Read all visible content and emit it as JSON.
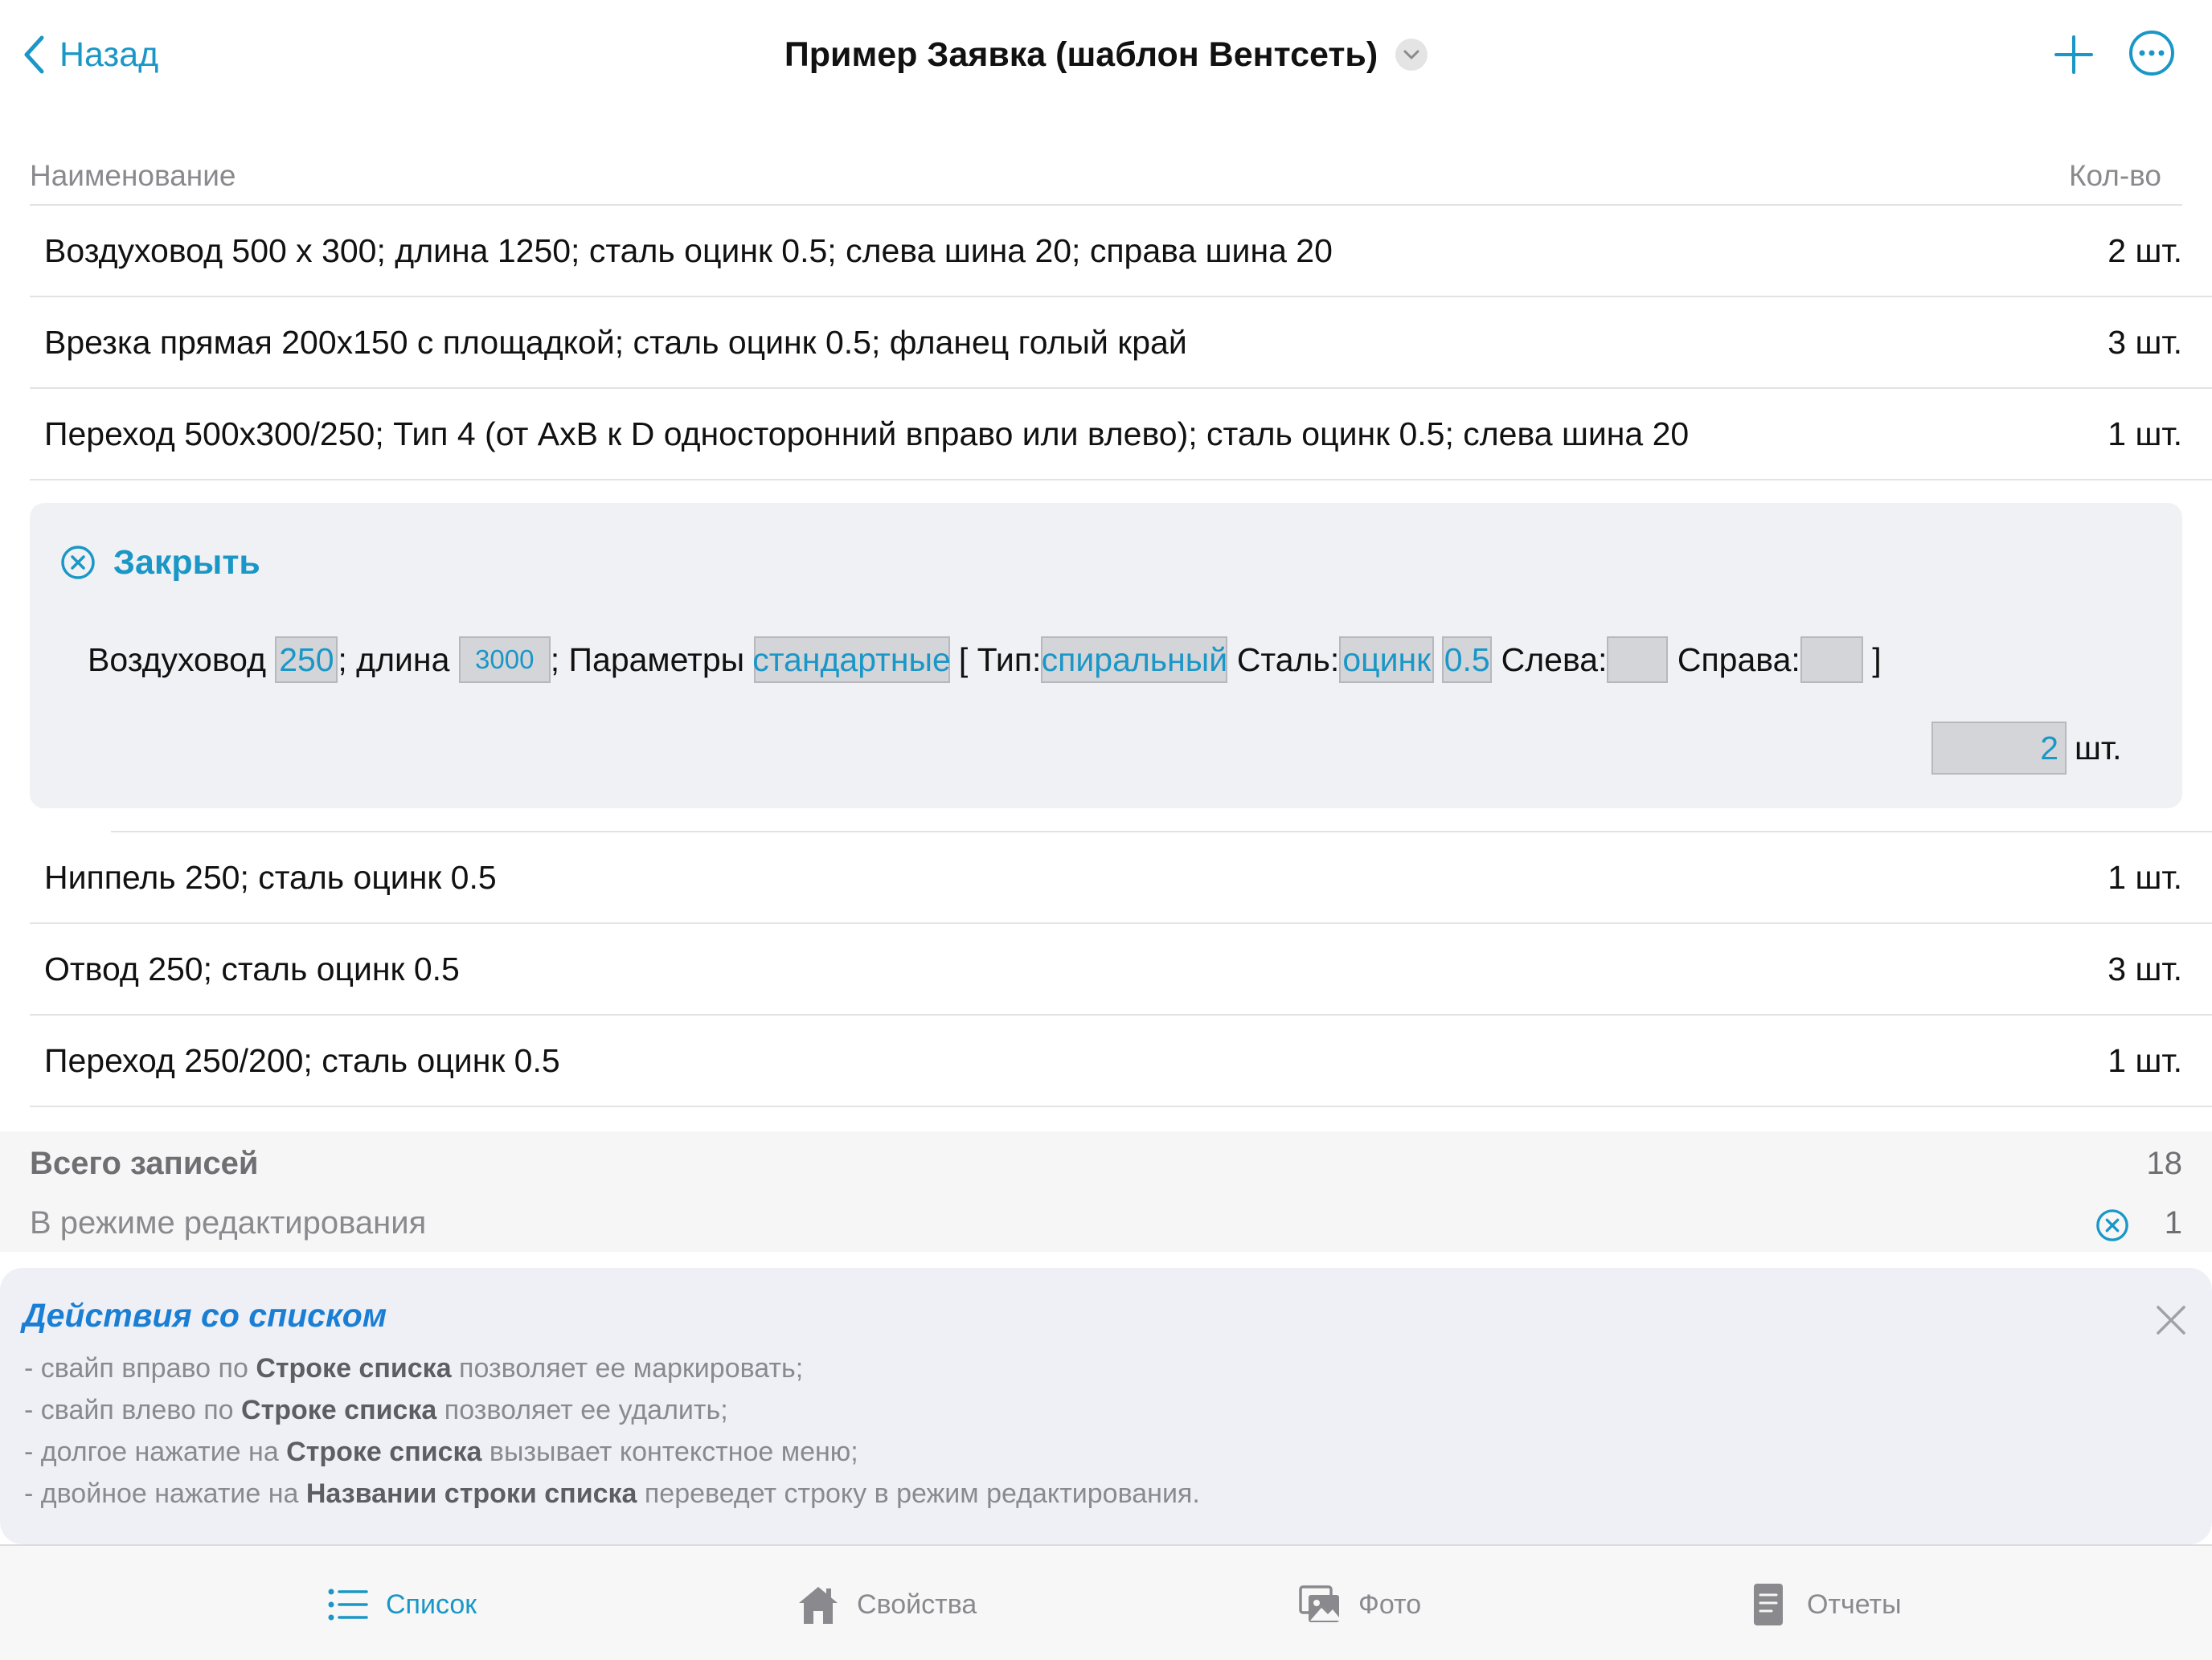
{
  "nav": {
    "back_label": "Назад",
    "title": "Пример Заявка (шаблон Вентсеть)"
  },
  "list": {
    "header_name": "Наименование",
    "header_qty": "Кол-во",
    "rows_before": [
      {
        "name": "Воздуховод 500 х 300; длина 1250; сталь оцинк 0.5; слева шина 20; справа шина 20",
        "qty": "2 шт."
      },
      {
        "name": "Врезка прямая 200х150 с площадкой; сталь оцинк 0.5; фланец голый край",
        "qty": "3 шт."
      },
      {
        "name": "Переход 500х300/250; Тип 4 (от AxB к D односторонний вправо или влево); сталь оцинк 0.5; слева шина 20",
        "qty": "1 шт."
      }
    ],
    "rows_after": [
      {
        "name": "Ниппель 250; сталь оцинк 0.5",
        "qty": "1 шт."
      },
      {
        "name": "Отвод 250; сталь оцинк 0.5",
        "qty": "3 шт."
      },
      {
        "name": "Переход 250/200; сталь оцинк 0.5",
        "qty": "1 шт."
      }
    ]
  },
  "editor": {
    "close_label": "Закрыть",
    "t_item": "Воздуховод ",
    "diameter": "250",
    "t_length": "; длина ",
    "length": "3000",
    "t_params": "; Параметры ",
    "params": "стандартные",
    "t_type": " [ Тип:",
    "type": "спиральный",
    "t_steel": " Сталь:",
    "steel": "оцинк",
    "thickness": "0.5",
    "t_left": " Слева:",
    "left": "",
    "t_right": " Справа:",
    "right": "",
    "t_end": " ]",
    "qty": "2",
    "unit": "шт."
  },
  "summary": {
    "total_label": "Всего записей",
    "total_value": "18",
    "editing_label": "В режиме редактирования",
    "editing_value": "1"
  },
  "tips": {
    "title": "Действия со списком",
    "lines": [
      {
        "pre": "- свайп вправо по ",
        "bold": "Строке списка",
        "post": " позволяет ее маркировать;"
      },
      {
        "pre": "- свайп влево по ",
        "bold": "Строке списка",
        "post": " позволяет ее удалить;"
      },
      {
        "pre": "- долгое нажатие на ",
        "bold": "Строке списка",
        "post": " вызывает контекстное меню;"
      },
      {
        "pre": "- двойное нажатие на ",
        "bold": "Названии строки списка",
        "post": " переведет строку в режим редактирования."
      }
    ]
  },
  "tabs": [
    {
      "label": "Список",
      "icon": "list-icon",
      "active": true
    },
    {
      "label": "Свойства",
      "icon": "house-icon",
      "active": false
    },
    {
      "label": "Фото",
      "icon": "photos-icon",
      "active": false
    },
    {
      "label": "Отчеты",
      "icon": "document-icon",
      "active": false
    }
  ],
  "colors": {
    "accent": "#1a97c6",
    "tips_title": "#1a7fd4",
    "field_bg": "#d4d5d9",
    "panel_bg": "#f0f1f4"
  }
}
